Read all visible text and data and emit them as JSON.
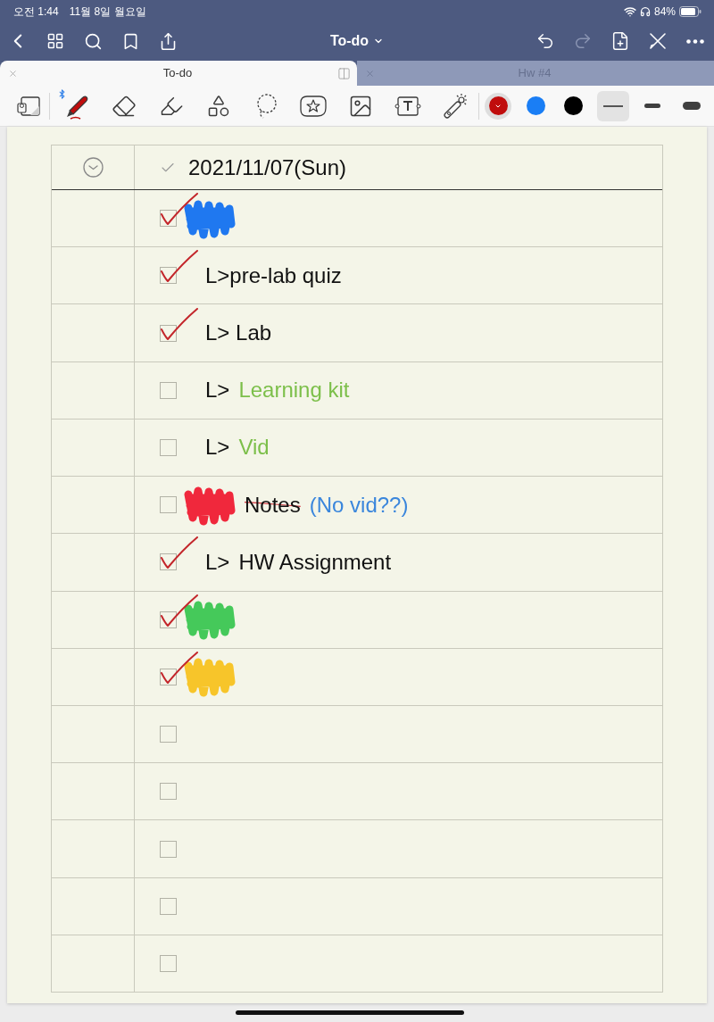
{
  "status_bar": {
    "time": "오전 1:44",
    "date": "11월 8일 월요일",
    "battery": "84%"
  },
  "nav": {
    "title": "To-do",
    "redo_disabled": true
  },
  "tabs": [
    {
      "label": "To-do",
      "selected": true
    },
    {
      "label": "Hw #4",
      "selected": false
    }
  ],
  "toolbar": {
    "stylus_connected": true,
    "tools": [
      {
        "kind": "pen",
        "selected": true
      },
      {
        "kind": "eraser",
        "selected": false
      },
      {
        "kind": "highlighter",
        "selected": false
      },
      {
        "kind": "shapes",
        "selected": false
      },
      {
        "kind": "lasso",
        "selected": false
      },
      {
        "kind": "sticker",
        "selected": false
      },
      {
        "kind": "image",
        "selected": false
      },
      {
        "kind": "text",
        "selected": false
      },
      {
        "kind": "laser",
        "selected": false
      }
    ],
    "colors": [
      {
        "color": "#c00d0d",
        "selected": true
      },
      {
        "color": "#1a7ef5",
        "selected": false
      },
      {
        "color": "#000000",
        "selected": false
      }
    ],
    "widths": [
      {
        "kind": "thin",
        "selected": true
      },
      {
        "kind": "medium",
        "selected": false
      },
      {
        "kind": "thick",
        "selected": false
      }
    ]
  },
  "todo": {
    "date": "2021/11/07(Sun)",
    "rows": [
      {
        "checked": true,
        "parts": [
          {
            "kind": "scribble",
            "color": "#1f78f0"
          }
        ]
      },
      {
        "checked": true,
        "parts": [
          {
            "kind": "ink",
            "text": "L>pre-lab quiz",
            "color": "#111111",
            "struck": false
          }
        ]
      },
      {
        "checked": true,
        "parts": [
          {
            "kind": "ink",
            "text": "L> Lab",
            "color": "#111111",
            "struck": false
          }
        ]
      },
      {
        "checked": false,
        "parts": [
          {
            "kind": "ink",
            "text": "L>",
            "color": "#111111",
            "struck": false
          },
          {
            "kind": "ink",
            "text": "Learning kit",
            "color": "#7cbf4a",
            "struck": false
          }
        ]
      },
      {
        "checked": false,
        "parts": [
          {
            "kind": "ink",
            "text": "L>",
            "color": "#111111",
            "struck": false
          },
          {
            "kind": "ink",
            "text": "Vid",
            "color": "#7cbf4a",
            "struck": false
          }
        ]
      },
      {
        "checked": false,
        "parts": [
          {
            "kind": "scribble",
            "color": "#f0283c"
          },
          {
            "kind": "ink",
            "text": "Notes",
            "color": "#111111",
            "struck": true
          },
          {
            "kind": "ink",
            "text": "(No vid??)",
            "color": "#3a86dc",
            "struck": false
          }
        ]
      },
      {
        "checked": true,
        "parts": [
          {
            "kind": "ink",
            "text": "L>",
            "color": "#111111",
            "struck": false
          },
          {
            "kind": "ink",
            "text": "HW Assignment",
            "color": "#111111",
            "struck": false
          }
        ]
      },
      {
        "checked": true,
        "parts": [
          {
            "kind": "scribble",
            "color": "#45c95a"
          }
        ]
      },
      {
        "checked": true,
        "parts": [
          {
            "kind": "scribble",
            "color": "#f7c52a"
          }
        ]
      },
      {
        "checked": false
      },
      {
        "checked": false
      },
      {
        "checked": false
      },
      {
        "checked": false
      },
      {
        "checked": false
      }
    ]
  }
}
